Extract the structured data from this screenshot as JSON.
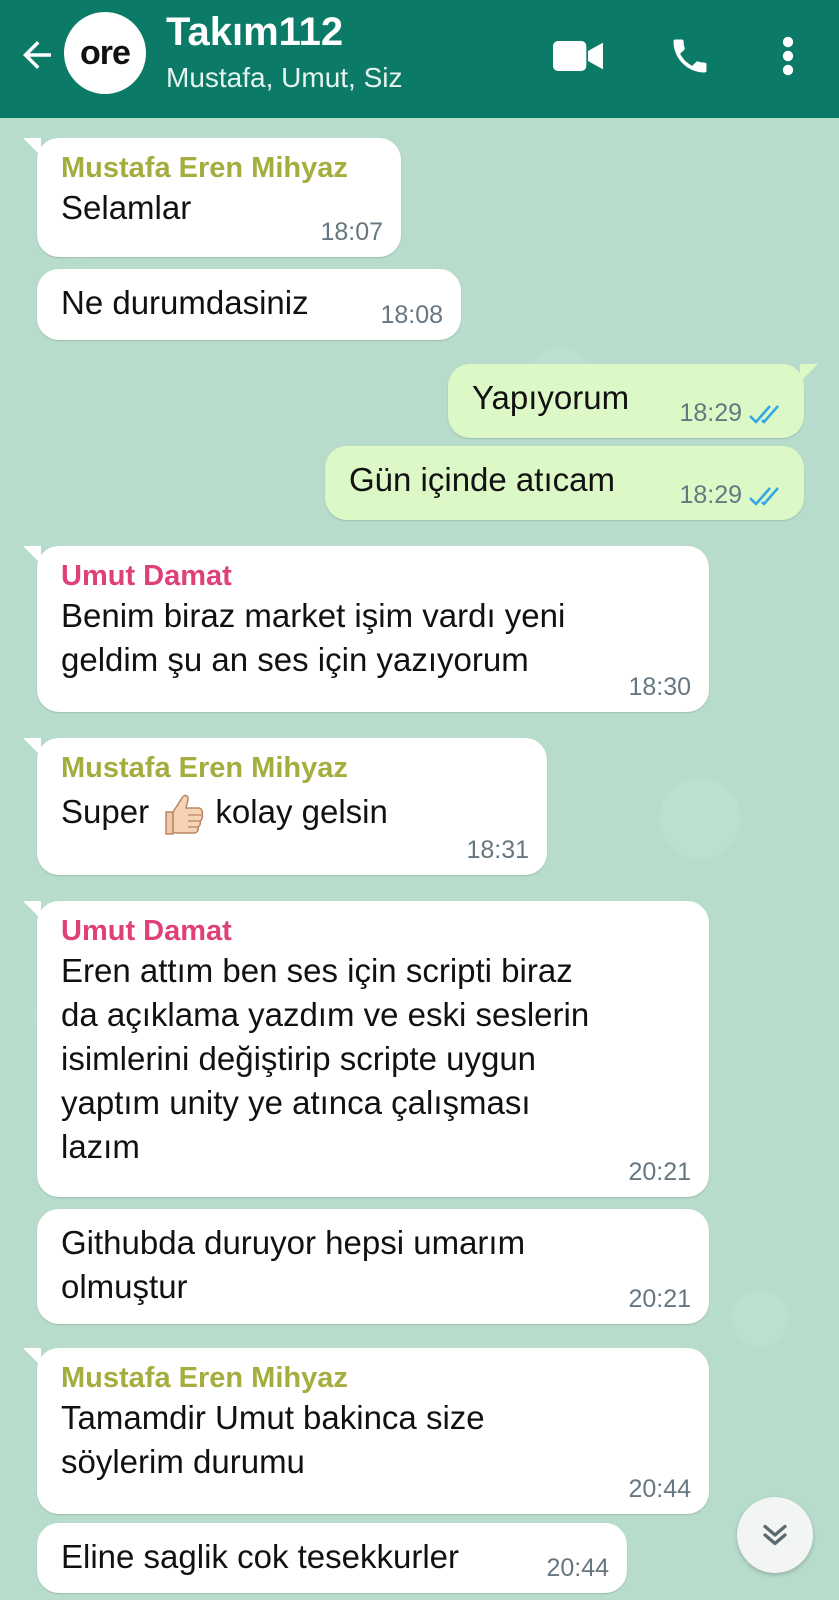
{
  "header": {
    "avatar_text": "ore",
    "title": "Takım112",
    "subtitle": "Mustafa, Umut, Siz"
  },
  "icons": [
    "back-arrow-icon",
    "video-call-icon",
    "phone-icon",
    "more-options-icon",
    "double-check-icon",
    "thumbs-up-emoji",
    "scroll-down-icon"
  ],
  "colors": {
    "header": "#0b7a66",
    "chat_bg": "#b7dccb",
    "incoming": "#ffffff",
    "outgoing": "#dcf8c6",
    "sender_mustafa": "#a4ad3e",
    "sender_umut": "#e0407a",
    "read_ticks": "#34a7e6"
  },
  "messages": [
    {
      "sender": "Mustafa Eren Mihyaz",
      "text": "Selamlar",
      "time": "18:07"
    },
    {
      "text": "Ne durumdasiniz",
      "time": "18:08"
    },
    {
      "text": "Yapıyorum",
      "time": "18:29",
      "outgoing": true,
      "status": "read"
    },
    {
      "text": "Gün içinde atıcam",
      "time": "18:29",
      "outgoing": true,
      "status": "read"
    },
    {
      "sender": "Umut Damat",
      "lines": [
        "Benim biraz market işim vardı yeni",
        "geldim şu an ses için yazıyorum"
      ],
      "time": "18:30"
    },
    {
      "sender": "Mustafa Eren Mihyaz",
      "text_before_emoji": "Super",
      "text_after_emoji": "kolay gelsin",
      "time": "18:31"
    },
    {
      "sender": "Umut Damat",
      "lines": [
        "Eren attım ben ses için scripti biraz",
        "da açıklama yazdım ve eski seslerin",
        "isimlerini değiştirip scripte uygun",
        "yaptım unity ye atınca çalışması",
        "lazım"
      ],
      "time": "20:21"
    },
    {
      "lines": [
        "Githubda duruyor hepsi umarım",
        "olmuştur"
      ],
      "time": "20:21"
    },
    {
      "sender": "Mustafa Eren Mihyaz",
      "lines": [
        "Tamamdir Umut bakinca size",
        "söylerim durumu"
      ],
      "time": "20:44"
    },
    {
      "text": "Eline saglik cok tesekkurler",
      "time": "20:44"
    }
  ]
}
